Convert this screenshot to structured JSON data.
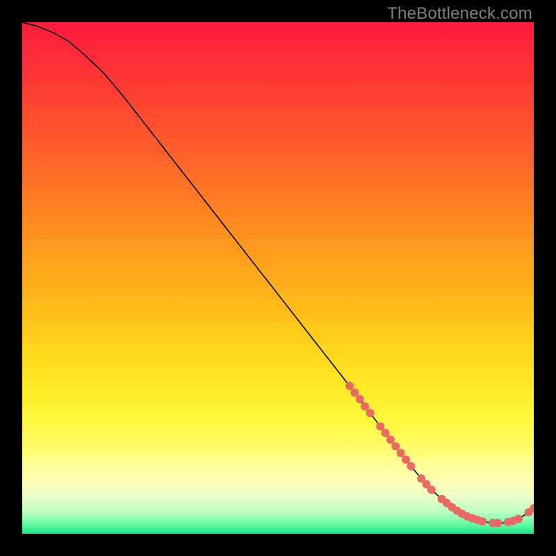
{
  "watermark": "TheBottleneck.com",
  "chart_data": {
    "type": "line",
    "title": "",
    "xlabel": "",
    "ylabel": "",
    "xlim": [
      0,
      100
    ],
    "ylim": [
      0,
      100
    ],
    "gradient_bands": [
      {
        "color": "#ff1c3f",
        "stop": 0.0
      },
      {
        "color": "#ff2a3a",
        "stop": 0.06
      },
      {
        "color": "#ff3a35",
        "stop": 0.12
      },
      {
        "color": "#ff4b30",
        "stop": 0.18
      },
      {
        "color": "#ff5c2b",
        "stop": 0.24
      },
      {
        "color": "#ff6e27",
        "stop": 0.3
      },
      {
        "color": "#ff8023",
        "stop": 0.36
      },
      {
        "color": "#ff921f",
        "stop": 0.42
      },
      {
        "color": "#ffa41c",
        "stop": 0.48
      },
      {
        "color": "#ffb61a",
        "stop": 0.54
      },
      {
        "color": "#ffc81a",
        "stop": 0.6
      },
      {
        "color": "#ffda1f",
        "stop": 0.66
      },
      {
        "color": "#ffeb2a",
        "stop": 0.72
      },
      {
        "color": "#fff83f",
        "stop": 0.78
      },
      {
        "color": "#fffb60",
        "stop": 0.82
      },
      {
        "color": "#fffd90",
        "stop": 0.86
      },
      {
        "color": "#fdffb8",
        "stop": 0.9
      },
      {
        "color": "#e8ffc8",
        "stop": 0.93
      },
      {
        "color": "#b8ffc0",
        "stop": 0.96
      },
      {
        "color": "#5cf7a0",
        "stop": 0.985
      },
      {
        "color": "#18e288",
        "stop": 1.0
      }
    ],
    "curve": {
      "x": [
        0,
        3,
        6,
        9,
        12,
        16,
        20,
        25,
        30,
        35,
        40,
        45,
        50,
        55,
        60,
        65,
        68,
        70,
        72,
        74,
        76,
        78,
        80,
        82,
        84,
        86,
        88,
        90,
        92,
        94,
        96,
        98,
        100
      ],
      "y": [
        100,
        99.2,
        98.0,
        96.3,
        93.8,
        90.0,
        85.2,
        78.8,
        72.4,
        66.0,
        59.6,
        53.2,
        46.8,
        40.4,
        34.0,
        27.6,
        23.6,
        21.0,
        18.4,
        15.8,
        13.2,
        10.8,
        8.6,
        6.8,
        5.2,
        3.9,
        3.0,
        2.4,
        2.1,
        2.1,
        2.5,
        3.5,
        5.0
      ]
    },
    "markers": {
      "x": [
        64,
        65,
        66,
        67,
        68,
        70,
        71,
        72,
        73,
        74,
        75,
        76,
        78,
        79,
        80,
        82,
        83,
        84,
        85,
        86,
        87,
        88,
        89,
        90,
        92,
        93,
        95,
        96,
        97,
        99,
        100
      ],
      "y": [
        28.9,
        27.6,
        26.3,
        24.9,
        23.6,
        21.0,
        19.7,
        18.4,
        17.1,
        15.8,
        14.5,
        13.2,
        10.8,
        9.7,
        8.6,
        6.8,
        6.0,
        5.2,
        4.5,
        3.9,
        3.4,
        3.0,
        2.7,
        2.4,
        2.1,
        2.1,
        2.3,
        2.5,
        2.9,
        4.2,
        5.0
      ],
      "color": "#e86a62",
      "radius_px": 6
    }
  }
}
